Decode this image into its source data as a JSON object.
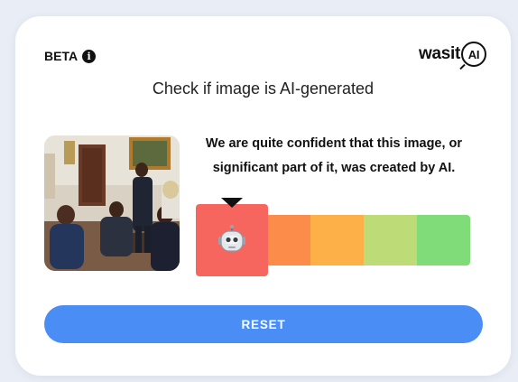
{
  "header": {
    "beta_label": "BETA",
    "info_icon": "i",
    "logo": {
      "prefix": "was",
      "accent": "it",
      "badge": "AI"
    }
  },
  "title": "Check if image is AI-generated",
  "result": {
    "line1": "We are quite confident that this image, or",
    "line2": "significant part of it, was created by AI.",
    "active_level": 1,
    "levels": 5,
    "active_icon": "robot-icon"
  },
  "colors": {
    "level1": "#f7665e",
    "level2": "#fb8c4a",
    "level3": "#fcb047",
    "level4": "#bddb76",
    "level5": "#7fdc78",
    "reset": "#4a8ef5"
  },
  "reset_label": "RESET"
}
